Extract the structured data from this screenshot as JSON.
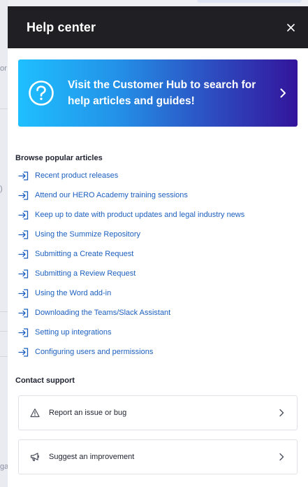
{
  "background": {
    "fragments": [
      "or",
      ")",
      "ga"
    ]
  },
  "header": {
    "title": "Help center",
    "close_icon": "close-icon"
  },
  "hub_banner": {
    "text": "Visit the Customer Hub to search for help articles and guides!",
    "icon": "question-circle-icon",
    "chevron": "chevron-right-icon",
    "gradient": [
      "#1fbfff",
      "#2392e8",
      "#2d4cbf",
      "#33149b"
    ]
  },
  "articles": {
    "title": "Browse popular articles",
    "icon": "sign-in-arrow-icon",
    "link_color": "#1c5fbf",
    "items": [
      {
        "label": "Recent product releases"
      },
      {
        "label": "Attend our HERO Academy training sessions"
      },
      {
        "label": "Keep up to date with product updates and legal industry news"
      },
      {
        "label": "Using the Summize Repository"
      },
      {
        "label": "Submitting a Create Request"
      },
      {
        "label": "Submitting a Review Request"
      },
      {
        "label": "Using the Word add-in"
      },
      {
        "label": "Downloading the Teams/Slack Assistant"
      },
      {
        "label": "Setting up integrations"
      },
      {
        "label": "Configuring users and permissions"
      }
    ]
  },
  "support": {
    "title": "Contact support",
    "items": [
      {
        "label": "Report an issue or bug",
        "icon": "warning-triangle-icon"
      },
      {
        "label": "Suggest an improvement",
        "icon": "megaphone-icon"
      }
    ]
  }
}
